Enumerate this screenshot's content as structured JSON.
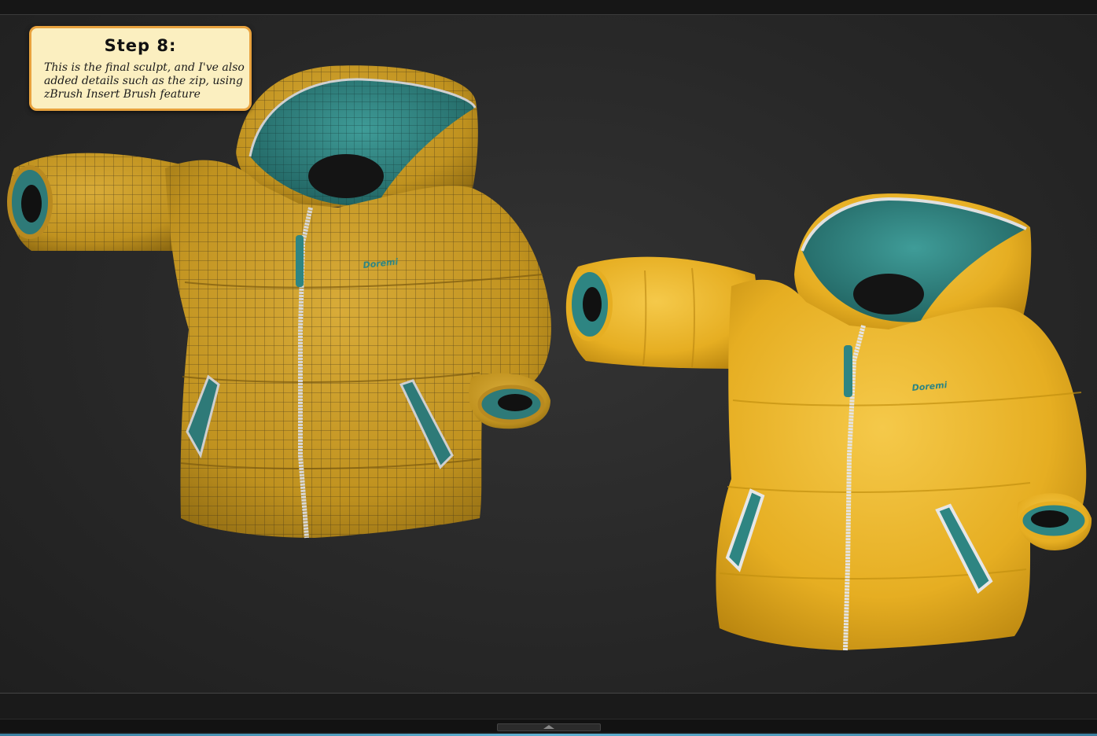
{
  "callout": {
    "title": "Step 8:",
    "body": "This is the final sculpt, and I've also added details such as the zip, using zBrush Insert Brush feature"
  },
  "models": [
    {
      "name": "wireframe-jacket",
      "brand_text": "Doremi",
      "body_color": "#c99a2a",
      "lining_color": "#2f7f7d",
      "wireframe": true
    },
    {
      "name": "final-jacket",
      "brand_text": "Doremi",
      "body_color": "#e9b52e",
      "lining_color": "#2e8582",
      "wireframe": false
    }
  ],
  "colors": {
    "viewport_bg": "#2a2a2a",
    "callout_bg": "#fbefc0",
    "callout_border": "#e8a23e",
    "zipper": "#d8d8d8",
    "accent": "#5fb0d0"
  }
}
